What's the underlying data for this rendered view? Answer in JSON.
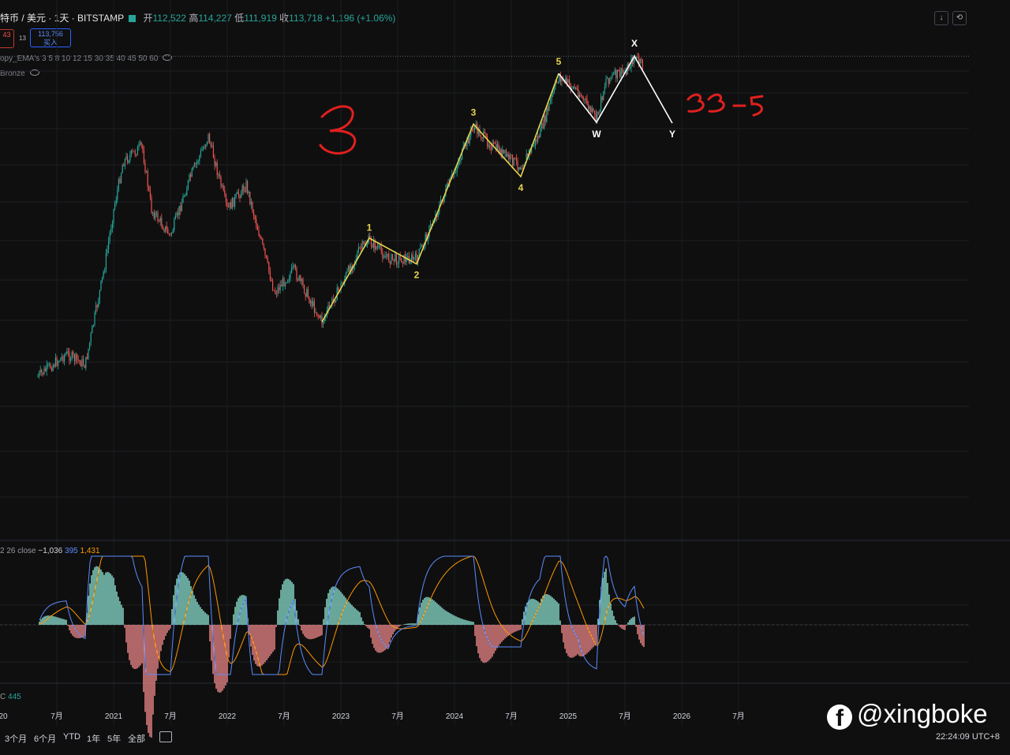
{
  "header": {
    "symbol": "特币 / 美元 · 1天 · BITSTAMP",
    "open_label": "开",
    "open_value": "112,522",
    "high_label": "高",
    "high_value": "114,227",
    "low_label": "低",
    "low_value": "111,919",
    "close_label": "收",
    "close_value": "113,718",
    "change": "+1,196 (+1.06%)"
  },
  "trade": {
    "sell_price": "43",
    "spread": "13",
    "buy_price": "113,756",
    "buy_label": "买入"
  },
  "indicators": {
    "ema": "opy_EMA's 3 5 8 10 12 15 30 35 40 45 50 60",
    "bronze": "Bronze",
    "macd_label": "2 26 close",
    "macd_value": "−1,036",
    "signal_value": "395",
    "hist_value": "1,431",
    "vol_label": "C",
    "vol_value": "445"
  },
  "annotations": {
    "big_three": "3",
    "pattern_note": "3-3-5"
  },
  "chart_data": {
    "type": "candlestick",
    "symbol": "BTC/USD",
    "interval": "1D",
    "price_range": [
      8000,
      125000
    ],
    "x_ticks": [
      "20",
      "7月",
      "2021",
      "7月",
      "2022",
      "7月",
      "2023",
      "7月",
      "2024",
      "7月",
      "2025",
      "7月",
      "2026",
      "7月"
    ],
    "price_path": [
      {
        "date": "2020-05",
        "price": 10500
      },
      {
        "date": "2020-08",
        "price": 12500
      },
      {
        "date": "2020-10",
        "price": 11500
      },
      {
        "date": "2020-12",
        "price": 24000
      },
      {
        "date": "2021-01",
        "price": 38000
      },
      {
        "date": "2021-02",
        "price": 55000
      },
      {
        "date": "2021-04",
        "price": 62000
      },
      {
        "date": "2021-05",
        "price": 38000
      },
      {
        "date": "2021-07",
        "price": 31000
      },
      {
        "date": "2021-09",
        "price": 48000
      },
      {
        "date": "2021-11",
        "price": 67000
      },
      {
        "date": "2022-01",
        "price": 38000
      },
      {
        "date": "2022-03",
        "price": 46000
      },
      {
        "date": "2022-06",
        "price": 20000
      },
      {
        "date": "2022-08",
        "price": 24000
      },
      {
        "date": "2022-11",
        "price": 16000
      },
      {
        "date": "2023-03",
        "price": 28000
      },
      {
        "date": "2023-04",
        "price": 30000
      },
      {
        "date": "2023-06",
        "price": 26000
      },
      {
        "date": "2023-09",
        "price": 26000
      },
      {
        "date": "2023-12",
        "price": 43000
      },
      {
        "date": "2024-03",
        "price": 72000
      },
      {
        "date": "2024-05",
        "price": 62000
      },
      {
        "date": "2024-08",
        "price": 53000
      },
      {
        "date": "2024-10",
        "price": 68000
      },
      {
        "date": "2024-12",
        "price": 106000
      },
      {
        "date": "2025-02",
        "price": 95000
      },
      {
        "date": "2025-04",
        "price": 76000
      },
      {
        "date": "2025-05",
        "price": 104000
      },
      {
        "date": "2025-07",
        "price": 110000
      },
      {
        "date": "2025-08",
        "price": 123000
      },
      {
        "date": "2025-09",
        "price": 114000
      }
    ],
    "wave_labels": [
      {
        "label": "1",
        "date": "2023-04",
        "price": 30000,
        "color": "#e8d44d"
      },
      {
        "label": "2",
        "date": "2023-09",
        "price": 25000,
        "color": "#e8d44d"
      },
      {
        "label": "3",
        "date": "2024-03",
        "price": 73000,
        "color": "#e8d44d"
      },
      {
        "label": "4",
        "date": "2024-08",
        "price": 49000,
        "color": "#e8d44d"
      },
      {
        "label": "5",
        "date": "2024-12",
        "price": 108000,
        "color": "#e8d44d"
      },
      {
        "label": "W",
        "date": "2025-04",
        "price": 74000,
        "color": "#ffffff"
      },
      {
        "label": "X",
        "date": "2025-08",
        "price": 124000,
        "color": "#ffffff"
      },
      {
        "label": "Y",
        "date": "2025-12",
        "price": 74000,
        "color": "#ffffff"
      }
    ],
    "impulse_wave": [
      {
        "date": "2022-11",
        "price": 16000
      },
      {
        "date": "2023-04",
        "price": 30500
      },
      {
        "date": "2023-09",
        "price": 25000
      },
      {
        "date": "2024-03",
        "price": 73500
      },
      {
        "date": "2024-08",
        "price": 49000
      },
      {
        "date": "2024-12",
        "price": 108500
      }
    ],
    "correction_wave": [
      {
        "date": "2024-12",
        "price": 108500
      },
      {
        "date": "2025-04",
        "price": 74500
      },
      {
        "date": "2025-08",
        "price": 124000
      },
      {
        "date": "2025-12",
        "price": 74000
      }
    ],
    "reference_line_price": 124000,
    "colors": {
      "up": "#26a69a",
      "down": "#ef5350",
      "impulse": "#e8d44d",
      "correction": "#ffffff",
      "macd": "#5b8cff",
      "signal": "#ff9800",
      "handwriting": "#e0201e"
    }
  }
}
